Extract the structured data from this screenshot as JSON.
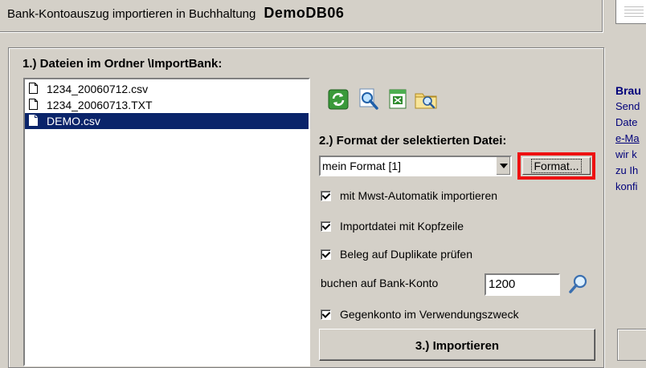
{
  "header": {
    "title": "Bank-Kontoauszug importieren in Buchhaltung",
    "database": "DemoDB06"
  },
  "section1": {
    "label": "1.) Dateien im Ordner \\ImportBank:",
    "files": [
      {
        "name": "1234_20060712.csv",
        "selected": false
      },
      {
        "name": "1234_20060713.TXT",
        "selected": false
      },
      {
        "name": "DEMO.csv",
        "selected": true
      }
    ]
  },
  "toolbar": {
    "icons": [
      "refresh-icon",
      "search-file-icon",
      "excel-icon",
      "folder-search-icon"
    ]
  },
  "section2": {
    "label": "2.) Format der selektierten Datei:",
    "format_value": "mein Format [1]",
    "format_button": "Format...",
    "checkboxes": [
      {
        "label": "mit Mwst-Automatik importieren",
        "checked": true
      },
      {
        "label": "Importdatei mit Kopfzeile",
        "checked": true
      },
      {
        "label": "Beleg auf Duplikate prüfen",
        "checked": true
      }
    ],
    "account_label": "buchen auf Bank-Konto",
    "account_value": "1200",
    "counter_checkbox": {
      "label": "Gegenkonto im Verwendungszweck",
      "checked": true
    }
  },
  "section3": {
    "import_button": "3.) Importieren"
  },
  "info_panel": {
    "title": "Brau",
    "lines": [
      "Send",
      "Date",
      "e-Ma",
      "wir k",
      "zu Ih",
      "konfi"
    ]
  },
  "colors": {
    "selection": "#0a246a",
    "highlight": "#e11111",
    "info_text": "#00007a"
  }
}
